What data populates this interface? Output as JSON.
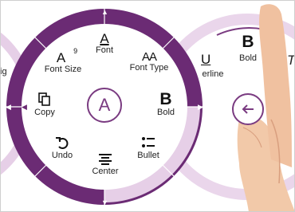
{
  "colors": {
    "accent": "#6b2b74",
    "accent_dark": "#5b2061",
    "ring_light": "#e6cfe7",
    "ring_lighter": "#f0e2f1"
  },
  "left_menu": {
    "font_size": {
      "label": "Font Size",
      "glyph": "A",
      "superscript": "9"
    },
    "font": {
      "label": "Font",
      "glyph": "A"
    },
    "font_type": {
      "label": "Font Type",
      "glyph": "AA"
    },
    "copy": {
      "label": "Copy"
    },
    "center": {
      "glyph": "A"
    },
    "bold": {
      "label": "Bold",
      "glyph": "B"
    },
    "undo": {
      "label": "Undo"
    },
    "center_align": {
      "label": "Center"
    },
    "bullet": {
      "label": "Bullet"
    },
    "partial_left_label": "ig"
  },
  "right_menu": {
    "bold": {
      "label": "Bold",
      "glyph": "B"
    },
    "underline": {
      "label": "erline",
      "glyph": "U"
    },
    "italic_glyph": "T"
  },
  "icons": [
    "copy-icon",
    "undo-icon",
    "center-align-icon",
    "bullet-list-icon",
    "back-arrow-icon",
    "hand-pointer-image"
  ]
}
